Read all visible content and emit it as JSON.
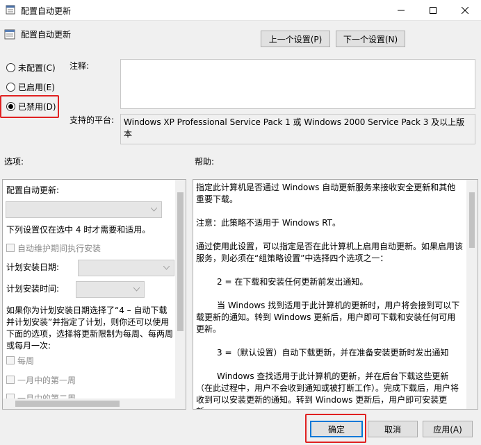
{
  "window": {
    "title": "配置自动更新"
  },
  "header": {
    "title": "配置自动更新"
  },
  "nav": {
    "prev_label": "上一个设置(P)",
    "next_label": "下一个设置(N)"
  },
  "state": {
    "options": [
      {
        "label": "未配置(C)",
        "selected": false
      },
      {
        "label": "已启用(E)",
        "selected": false
      },
      {
        "label": "已禁用(D)",
        "selected": true
      }
    ]
  },
  "comment": {
    "label": "注释:",
    "value": ""
  },
  "platform": {
    "label": "支持的平台:",
    "value": "Windows XP Professional Service Pack 1 或 Windows 2000 Service Pack 3 及以上版本"
  },
  "options_pane": {
    "label": "选项:",
    "configure_label": "配置自动更新:",
    "note": "下列设置仅在选中 4 时才需要和适用。",
    "maintenance_checkbox": "自动维护期间执行安装",
    "schedule_day_label": "计划安装日期:",
    "schedule_time_label": "计划安装时间:",
    "explain": "如果你为计划安装日期选择了“4 – 自动下载并计划安装”并指定了计划，则你还可以使用下面的选项，选择将更新限制为每周、每两周或每月一次:",
    "weekly_checkbox": "每周",
    "first_week_checkbox": "一月中的第一周",
    "second_week_checkbox": "一月中的第二周"
  },
  "help_pane": {
    "label": "帮助:",
    "paragraphs": [
      "指定此计算机是否通过 Windows 自动更新服务来接收安全更新和其他重要下载。",
      "注意：此策略不适用于 Windows RT。",
      "通过使用此设置，可以指定是否在此计算机上启用自动更新。如果启用该服务，则必须在“组策略设置”中选择四个选项之一：",
      "2 = 在下载和安装任何更新前发出通知。",
      "当 Windows 找到适用于此计算机的更新时，用户将会接到可以下载更新的通知。转到 Windows 更新后，用户即可下载和安装任何可用更新。",
      "3 =（默认设置）自动下载更新，并在准备安装更新时发出通知",
      "Windows 查找适用于此计算机的更新，并在后台下载这些更新（在此过程中，用户不会收到通知或被打断工作）。完成下载后，用户将收到可以安装更新的通知。转到 Windows 更新后，用户即可安装更新。"
    ]
  },
  "footer": {
    "ok_label": "确定",
    "cancel_label": "取消",
    "apply_label": "应用(A)"
  }
}
